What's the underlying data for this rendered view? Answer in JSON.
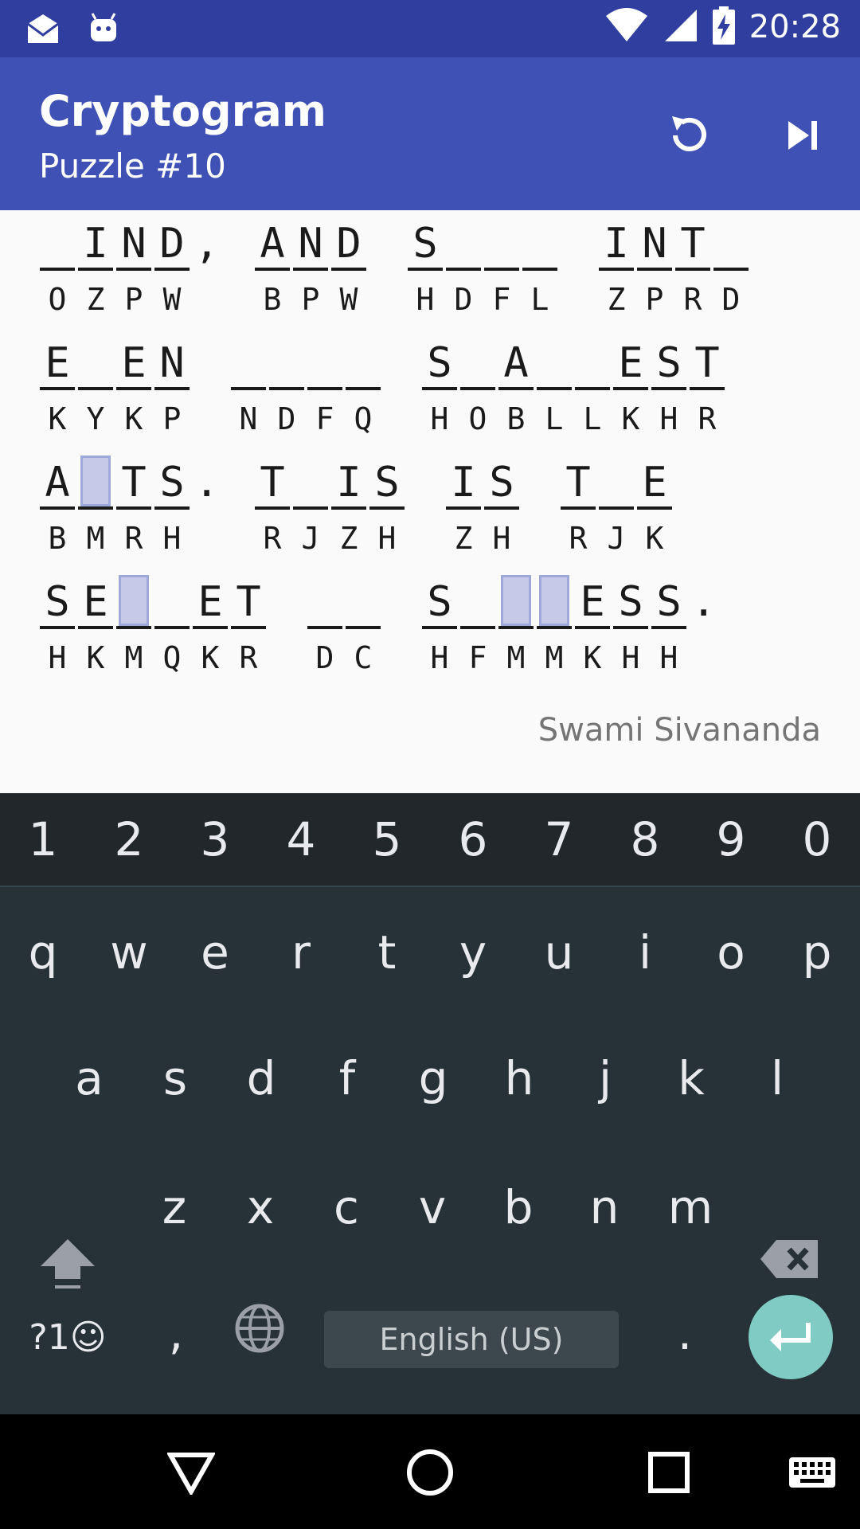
{
  "status_bar": {
    "time": "20:28",
    "icons": [
      "mail-icon",
      "android-icon",
      "wifi-icon",
      "signal-icon",
      "battery-charging-icon"
    ]
  },
  "app_bar": {
    "title": "Cryptogram",
    "subtitle": "Puzzle #10",
    "actions": [
      "undo-icon",
      "skip-next-icon"
    ]
  },
  "puzzle": {
    "lines": [
      [
        {
          "cells": [
            {
              "p": "",
              "c": "O"
            },
            {
              "p": "I",
              "c": "Z"
            },
            {
              "p": "N",
              "c": "P"
            },
            {
              "p": "D",
              "c": "W"
            }
          ],
          "after": ","
        },
        {
          "cells": [
            {
              "p": "A",
              "c": "B"
            },
            {
              "p": "N",
              "c": "P"
            },
            {
              "p": "D",
              "c": "W"
            }
          ]
        },
        {
          "cells": [
            {
              "p": "S",
              "c": "H"
            },
            {
              "p": "",
              "c": "D"
            },
            {
              "p": "",
              "c": "F"
            },
            {
              "p": "",
              "c": "L"
            }
          ]
        },
        {
          "cells": [
            {
              "p": "I",
              "c": "Z"
            },
            {
              "p": "N",
              "c": "P"
            },
            {
              "p": "T",
              "c": "R"
            },
            {
              "p": "",
              "c": "D"
            }
          ]
        }
      ],
      [
        {
          "cells": [
            {
              "p": "E",
              "c": "K"
            },
            {
              "p": "",
              "c": "Y"
            },
            {
              "p": "E",
              "c": "K"
            },
            {
              "p": "N",
              "c": "P"
            }
          ]
        },
        {
          "cells": [
            {
              "p": "",
              "c": "N"
            },
            {
              "p": "",
              "c": "D"
            },
            {
              "p": "",
              "c": "F"
            },
            {
              "p": "",
              "c": "Q"
            }
          ]
        },
        {
          "cells": [
            {
              "p": "S",
              "c": "H"
            },
            {
              "p": "",
              "c": "O"
            },
            {
              "p": "A",
              "c": "B"
            },
            {
              "p": "",
              "c": "L"
            },
            {
              "p": "",
              "c": "L"
            },
            {
              "p": "E",
              "c": "K"
            },
            {
              "p": "S",
              "c": "H"
            },
            {
              "p": "T",
              "c": "R"
            }
          ]
        }
      ],
      [
        {
          "cells": [
            {
              "p": "A",
              "c": "B"
            },
            {
              "p": "",
              "c": "M",
              "h": true
            },
            {
              "p": "T",
              "c": "R"
            },
            {
              "p": "S",
              "c": "H"
            }
          ],
          "after": "."
        },
        {
          "cells": [
            {
              "p": "T",
              "c": "R"
            },
            {
              "p": "",
              "c": "J"
            },
            {
              "p": "I",
              "c": "Z"
            },
            {
              "p": "S",
              "c": "H"
            }
          ]
        },
        {
          "cells": [
            {
              "p": "I",
              "c": "Z"
            },
            {
              "p": "S",
              "c": "H"
            }
          ]
        },
        {
          "cells": [
            {
              "p": "T",
              "c": "R"
            },
            {
              "p": "",
              "c": "J"
            },
            {
              "p": "E",
              "c": "K"
            }
          ]
        }
      ],
      [
        {
          "cells": [
            {
              "p": "S",
              "c": "H"
            },
            {
              "p": "E",
              "c": "K"
            },
            {
              "p": "",
              "c": "M",
              "h": true
            },
            {
              "p": "",
              "c": "Q"
            },
            {
              "p": "E",
              "c": "K"
            },
            {
              "p": "T",
              "c": "R"
            }
          ]
        },
        {
          "cells": [
            {
              "p": "",
              "c": "D"
            },
            {
              "p": "",
              "c": "C"
            }
          ]
        },
        {
          "cells": [
            {
              "p": "S",
              "c": "H"
            },
            {
              "p": "",
              "c": "F"
            },
            {
              "p": "",
              "c": "M",
              "h": true
            },
            {
              "p": "",
              "c": "M",
              "h": true
            },
            {
              "p": "E",
              "c": "K"
            },
            {
              "p": "S",
              "c": "H"
            },
            {
              "p": "S",
              "c": "H"
            }
          ],
          "after": "."
        }
      ]
    ],
    "author": "Swami Sivananda"
  },
  "keyboard": {
    "number_row": [
      "1",
      "2",
      "3",
      "4",
      "5",
      "6",
      "7",
      "8",
      "9",
      "0"
    ],
    "row1": [
      "q",
      "w",
      "e",
      "r",
      "t",
      "y",
      "u",
      "i",
      "o",
      "p"
    ],
    "row2": [
      "a",
      "s",
      "d",
      "f",
      "g",
      "h",
      "j",
      "k",
      "l"
    ],
    "row3": [
      "z",
      "x",
      "c",
      "v",
      "b",
      "n",
      "m"
    ],
    "symbols_label": "?1☺",
    "comma": ",",
    "period": ".",
    "space_label": "English (US)",
    "accent_color": "#80cbc4"
  },
  "nav_bar": {
    "buttons": [
      "back-icon",
      "home-icon",
      "recents-icon",
      "keyboard-icon"
    ]
  }
}
